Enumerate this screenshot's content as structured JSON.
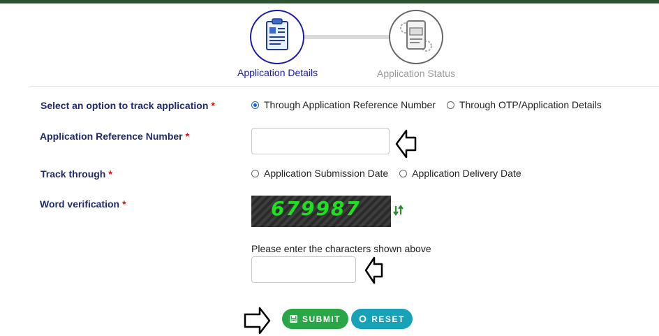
{
  "stepper": {
    "steps": [
      {
        "label": "Application Details",
        "icon": "clipboard-icon",
        "active": true
      },
      {
        "label": "Application Status",
        "icon": "document-gear-icon",
        "active": false
      }
    ]
  },
  "form": {
    "track_option": {
      "label": "Select an option to track application",
      "required": "*",
      "options": [
        "Through Application Reference Number",
        "Through OTP/Application Details"
      ],
      "selected": "Through Application Reference Number"
    },
    "reference_number": {
      "label": "Application Reference Number",
      "required": "*",
      "value": ""
    },
    "track_through": {
      "label": "Track through",
      "required": "*",
      "options": [
        "Application Submission Date",
        "Application Delivery Date"
      ]
    },
    "word_verification": {
      "label": "Word verification",
      "required": "*",
      "captcha_text": "679987",
      "hint": "Please enter the characters shown above",
      "value": ""
    }
  },
  "buttons": {
    "submit": "SUBMIT",
    "reset": "RESET"
  },
  "colors": {
    "top_bar": "#2f5233",
    "label": "#1f2a6b",
    "required": "#d01010",
    "submit": "#2aa648",
    "reset": "#17a2b8",
    "captcha_text": "#1fe01f"
  }
}
